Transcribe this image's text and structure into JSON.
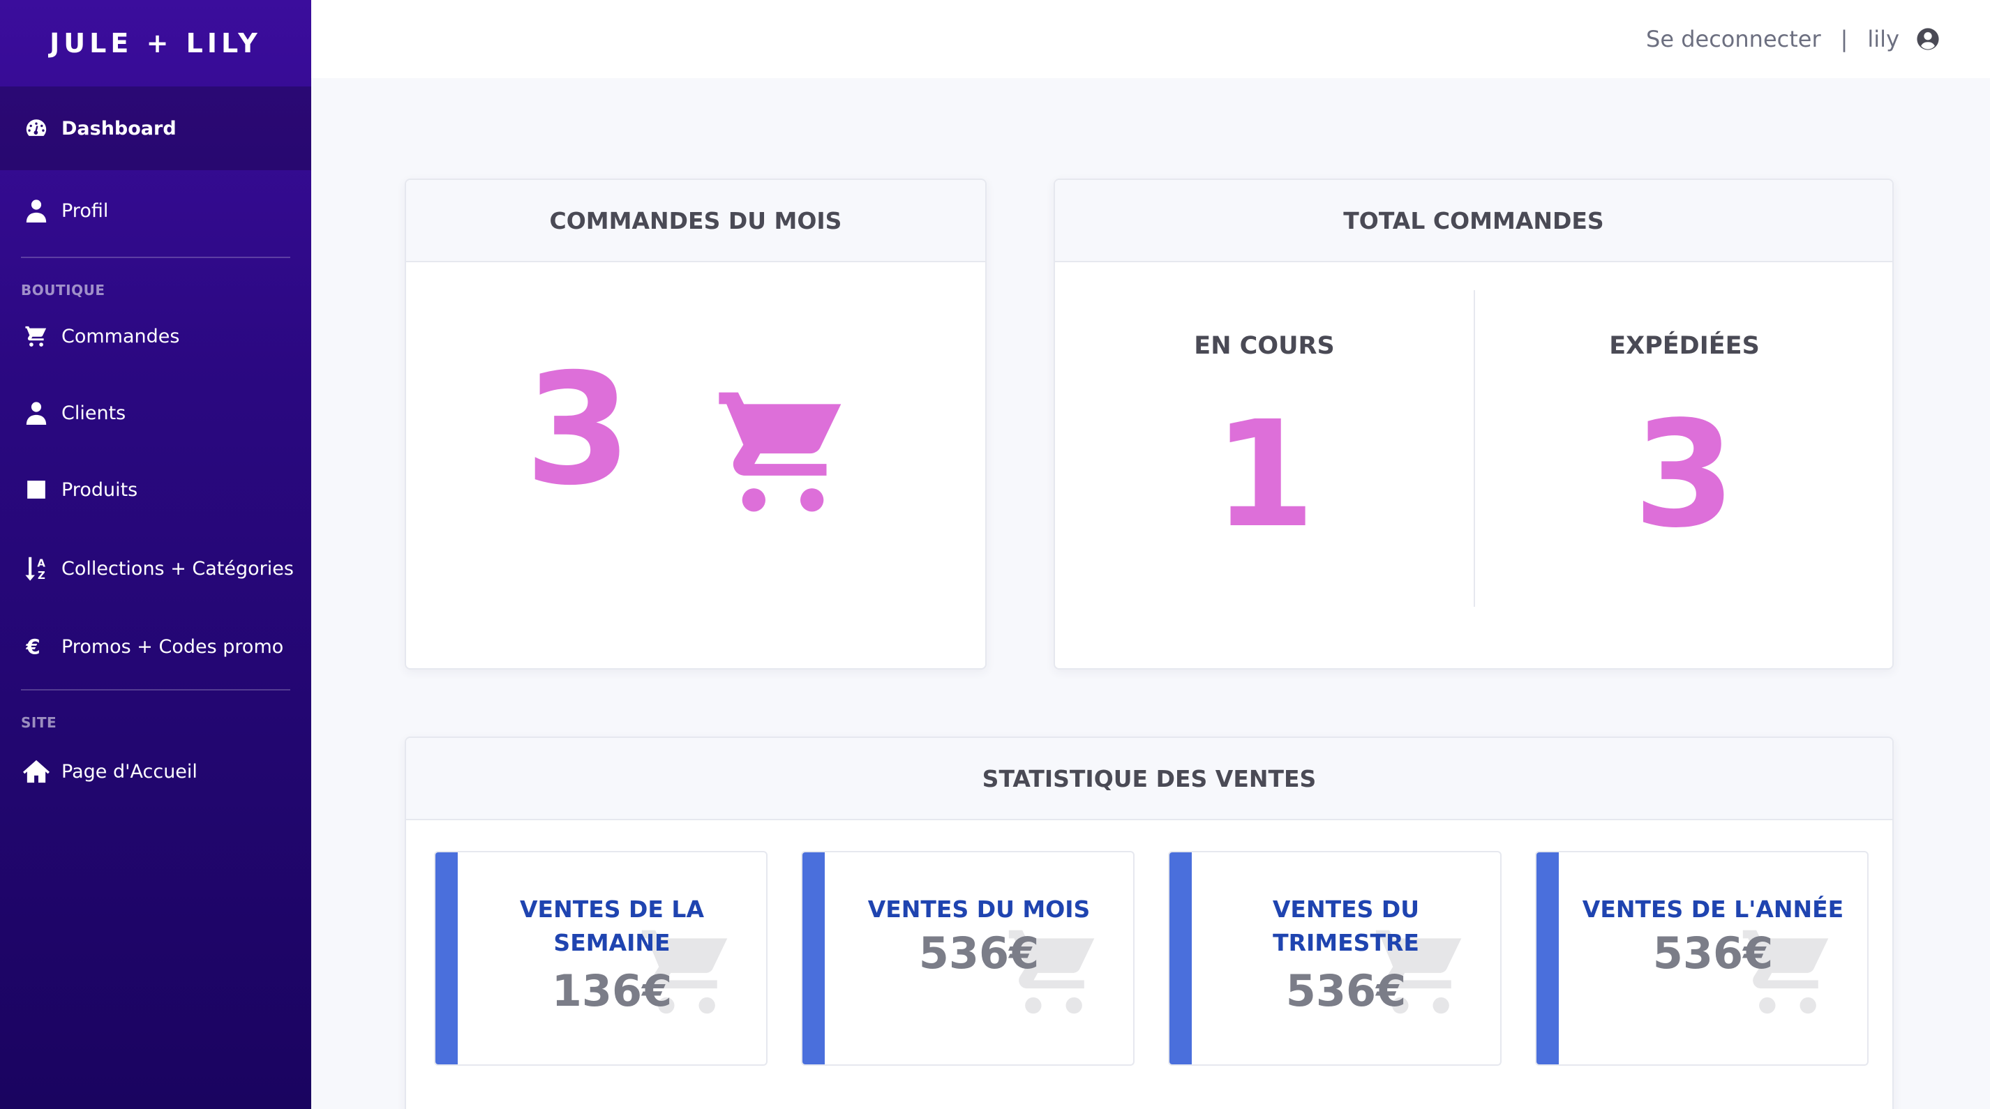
{
  "brand": "JULE + LILY",
  "sidebar": {
    "items": [
      {
        "label": "Dashboard",
        "icon": "dashboard-icon"
      },
      {
        "label": "Profil",
        "icon": "user-icon"
      }
    ],
    "section_boutique": "BOUTIQUE",
    "boutique_items": [
      {
        "label": "Commandes",
        "icon": "cart-icon"
      },
      {
        "label": "Clients",
        "icon": "user-icon"
      },
      {
        "label": "Produits",
        "icon": "square-icon"
      },
      {
        "label": "Collections + Catégories",
        "icon": "sort-az-icon"
      },
      {
        "label": "Promos + Codes promo",
        "icon": "euro-icon"
      }
    ],
    "section_site": "SITE",
    "site_items": [
      {
        "label": "Page d'Accueil",
        "icon": "home-icon"
      }
    ]
  },
  "topbar": {
    "logout": "Se deconnecter",
    "separator": "|",
    "username": "lily"
  },
  "cards": {
    "month_orders": {
      "title": "COMMANDES DU MOIS",
      "value": "3"
    },
    "total_orders": {
      "title": "TOTAL COMMANDES",
      "in_progress_label": "EN COURS",
      "in_progress_value": "1",
      "shipped_label": "EXPÉDIÉES",
      "shipped_value": "3"
    },
    "sales": {
      "title": "STATISTIQUE DES VENTES",
      "tiles": [
        {
          "label_l1": "VENTES DE LA",
          "label_l2": "SEMAINE",
          "amount": "136€"
        },
        {
          "label_l1": "VENTES DU MOIS",
          "label_l2": "",
          "amount": "536€"
        },
        {
          "label_l1": "VENTES DU",
          "label_l2": "TRIMESTRE",
          "amount": "536€"
        },
        {
          "label_l1": "VENTES DE L'ANNÉE",
          "label_l2": "",
          "amount": "536€"
        }
      ]
    }
  },
  "colors": {
    "sidebar_top": "#3b0d9c",
    "sidebar_bottom": "#1a0460",
    "accent_pink": "#dd6fd9",
    "stat_blue": "#4a6fdc",
    "stat_label": "#1f44b0"
  }
}
